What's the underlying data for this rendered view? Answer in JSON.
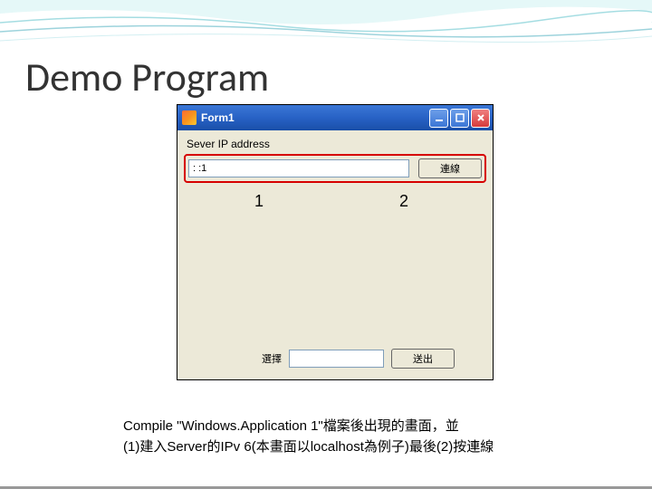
{
  "slide": {
    "title": "Demo Program"
  },
  "window": {
    "title": "Form1",
    "labels": {
      "server_ip": "Sever IP address",
      "select": "選擇"
    },
    "inputs": {
      "ip_value": ": :1",
      "select_value": ""
    },
    "buttons": {
      "connect": "連線",
      "send": "送出"
    },
    "controls": {
      "minimize": "_",
      "maximize": "□",
      "close": "✕"
    }
  },
  "callouts": {
    "first": "1",
    "second": "2"
  },
  "caption": {
    "line1": "Compile \"Windows.Application 1\"檔案後出現的畫面，並",
    "line2": "(1)建入Server的IPv 6(本畫面以localhost為例子)最後(2)按連線"
  }
}
